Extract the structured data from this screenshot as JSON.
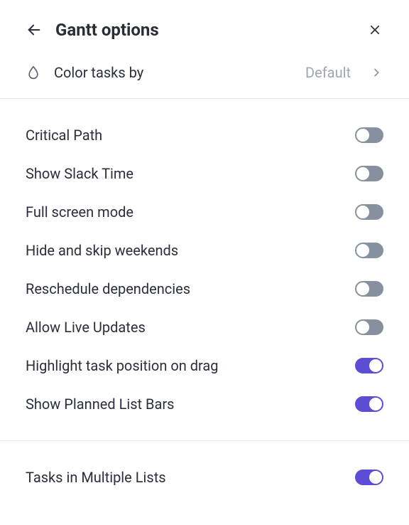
{
  "header": {
    "title": "Gantt options"
  },
  "colorRow": {
    "label": "Color tasks by",
    "value": "Default"
  },
  "options": [
    {
      "label": "Critical Path",
      "on": false
    },
    {
      "label": "Show Slack Time",
      "on": false
    },
    {
      "label": "Full screen mode",
      "on": false
    },
    {
      "label": "Hide and skip weekends",
      "on": false
    },
    {
      "label": "Reschedule dependencies",
      "on": false
    },
    {
      "label": "Allow Live Updates",
      "on": false
    },
    {
      "label": "Highlight task position on drag",
      "on": true
    },
    {
      "label": "Show Planned List Bars",
      "on": true
    }
  ],
  "secondary": [
    {
      "label": "Tasks in Multiple Lists",
      "on": true
    }
  ]
}
